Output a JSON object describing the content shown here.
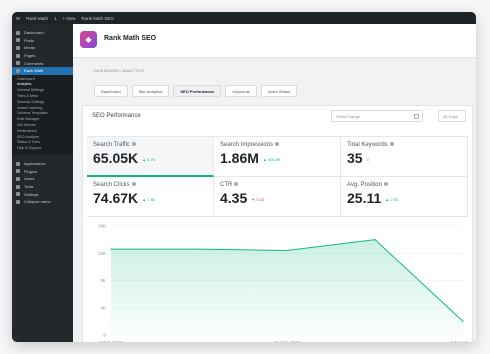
{
  "topbar": {
    "items": [
      "W",
      "Rank Math",
      "1",
      "+ New",
      "Rank Math SEO"
    ]
  },
  "sidebar": {
    "items_top": [
      "Dashboard",
      "Posts",
      "Media",
      "Pages",
      "Comments"
    ],
    "active": "Rank Math",
    "sub": [
      "Dashboard",
      "Analytics",
      "General Settings",
      "Titles & Meta",
      "Sitemap Settings",
      "Instant Indexing",
      "Schema Templates",
      "Role Manager",
      "404 Monitor",
      "Redirections",
      "SEO Analyzer",
      "Status & Tools",
      "Help & Support"
    ],
    "sub_current": 1,
    "items_bottom": [
      "Appearance",
      "Plugins",
      "Users",
      "Tools",
      "Settings",
      "Collapse menu"
    ]
  },
  "header": {
    "title": "Rank Math SEO"
  },
  "breadcrumb": "DASHBOARD / ANALYTICS",
  "tabs": [
    "Dashboard",
    "Site Analytics",
    "SEO Performance",
    "Keywords",
    "Index Status"
  ],
  "active_tab": 2,
  "section": {
    "title": "SEO Performance",
    "date_placeholder": "Select Range",
    "period": "30 Days"
  },
  "metrics": [
    {
      "label": "Search Traffic",
      "value": "65.05K",
      "delta": "▲ 5.7K",
      "trend": "up",
      "active": true
    },
    {
      "label": "Search Impressions",
      "value": "1.86M",
      "delta": "▲ 300.9K",
      "trend": "up"
    },
    {
      "label": "Total Keywords",
      "value": "35",
      "delta": "0",
      "trend": "neutral"
    },
    {
      "label": "Search Clicks",
      "value": "74.67K",
      "delta": "▲ 7.6K",
      "trend": "up"
    },
    {
      "label": "CTR",
      "value": "4.35",
      "delta": "▼ 0.32",
      "trend": "down"
    },
    {
      "label": "Avg. Position",
      "value": "25.11",
      "delta": "▲ 2.53",
      "trend": "up"
    }
  ],
  "colors": {
    "accent": "#10b981",
    "down": "#e0454b",
    "sidebar_active": "#2271b1"
  },
  "chart_data": {
    "type": "area",
    "x": [
      "7 Oct, 2020",
      "13 Oct, 2020",
      "19 Oct, 2020",
      "25 Oct, 2020",
      "1 Nov, 2020"
    ],
    "series": [
      {
        "values": [
          12600,
          12600,
          12400,
          14000,
          2000
        ]
      }
    ],
    "xticks": [
      "7 Oct, 2020",
      "19 Oct, 2020",
      "1 Nov, 2020"
    ],
    "yticks": [
      "0",
      "4K",
      "8K",
      "12K",
      "16K"
    ],
    "ylim": [
      0,
      16000
    ],
    "grid": true
  }
}
